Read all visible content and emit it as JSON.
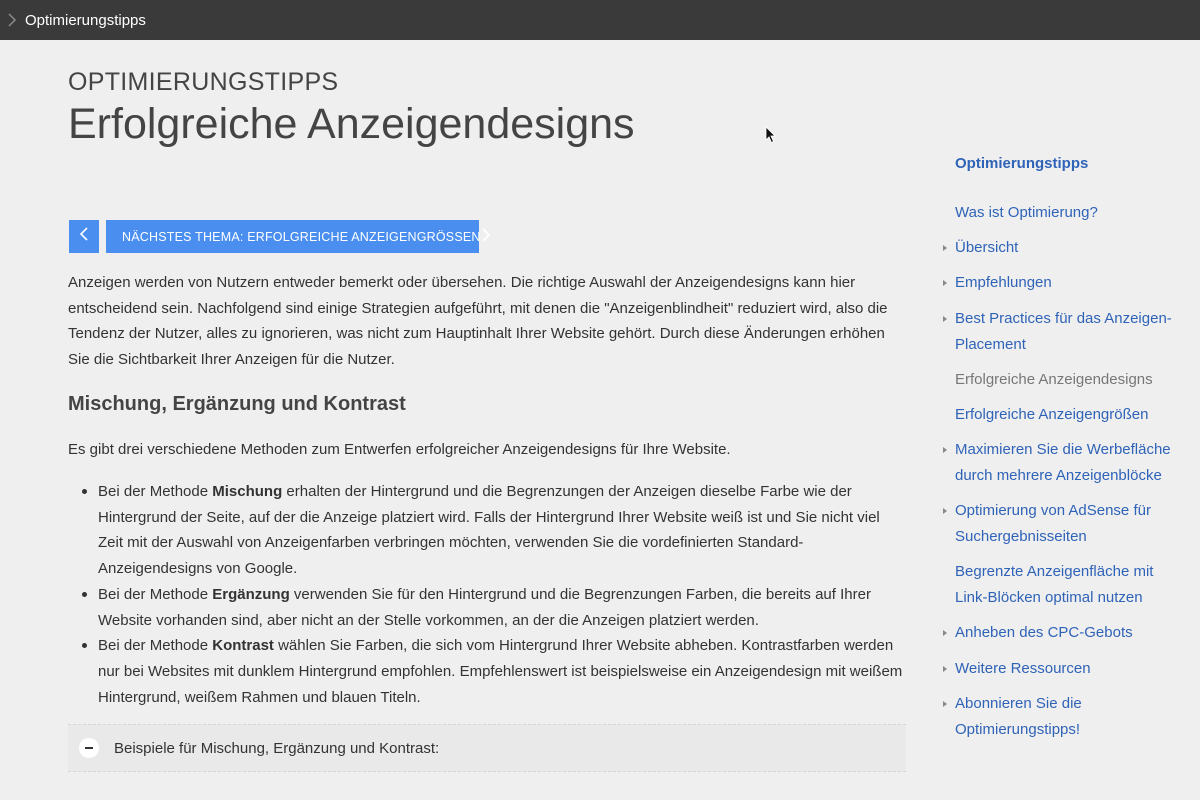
{
  "topbar": {
    "title": "Optimierungstipps"
  },
  "header": {
    "eyebrow": "OPTIMIERUNGSTIPPS",
    "title": "Erfolgreiche Anzeigendesigns"
  },
  "nav": {
    "next_label": "NÄCHSTES THEMA: ERFOLGREICHE ANZEIGENGRÖSSEN"
  },
  "intro": "Anzeigen werden von Nutzern entweder bemerkt oder übersehen. Die richtige Auswahl der Anzeigendesigns kann hier entscheidend sein. Nachfolgend sind einige Strategien aufgeführt, mit denen die \"Anzeigenblindheit\" reduziert wird, also die Tendenz der Nutzer, alles zu ignorieren, was nicht zum Hauptinhalt Ihrer Website gehört. Durch diese Änderungen erhöhen Sie die Sichtbarkeit Ihrer Anzeigen für die Nutzer.",
  "section": {
    "heading": "Mischung, Ergänzung und Kontrast",
    "lead": "Es gibt drei verschiedene Methoden zum Entwerfen erfolgreicher Anzeigendesigns für Ihre Website.",
    "bullets": [
      {
        "pre": "Bei der Methode ",
        "bold": "Mischung",
        "post": " erhalten der Hintergrund und die Begrenzungen der Anzeigen dieselbe Farbe wie der Hintergrund der Seite, auf der die Anzeige platziert wird. Falls der Hintergrund Ihrer Website weiß ist und Sie nicht viel Zeit mit der Auswahl von Anzeigenfarben verbringen möchten, verwenden Sie die vordefinierten Standard-Anzeigendesigns von Google."
      },
      {
        "pre": "Bei der Methode ",
        "bold": "Ergänzung",
        "post": " verwenden Sie für den Hintergrund und die Begrenzungen Farben, die bereits auf Ihrer Website vorhanden sind, aber nicht an der Stelle vorkommen, an der die Anzeigen platziert werden."
      },
      {
        "pre": "Bei der Methode ",
        "bold": "Kontrast",
        "post": " wählen Sie Farben, die sich vom Hintergrund Ihrer Website abheben. Kontrastfarben werden nur bei Websites mit dunklem Hintergrund empfohlen. Empfehlenswert ist beispielsweise ein Anzeigendesign mit weißem Hintergrund, weißem Rahmen und blauen Titeln."
      }
    ],
    "accordion_label": "Beispiele für Mischung, Ergänzung und Kontrast:"
  },
  "sidebar": {
    "heading": "Optimierungstipps",
    "items": [
      {
        "label": "Was ist Optimierung?",
        "caret": false,
        "current": false
      },
      {
        "label": "Übersicht",
        "caret": true,
        "current": false
      },
      {
        "label": "Empfehlungen",
        "caret": true,
        "current": false
      },
      {
        "label": "Best Practices für das Anzeigen-Placement",
        "caret": true,
        "current": false
      },
      {
        "label": "Erfolgreiche Anzeigendesigns",
        "caret": false,
        "current": true
      },
      {
        "label": "Erfolgreiche Anzeigengrößen",
        "caret": false,
        "current": false
      },
      {
        "label": "Maximieren Sie die Werbefläche durch mehrere Anzeigenblöcke",
        "caret": true,
        "current": false
      },
      {
        "label": "Optimierung von AdSense für Suchergebnisseiten",
        "caret": true,
        "current": false
      },
      {
        "label": "Begrenzte Anzeigenfläche mit Link-Blöcken optimal nutzen",
        "caret": false,
        "current": false
      },
      {
        "label": "Anheben des CPC-Gebots",
        "caret": true,
        "current": false
      },
      {
        "label": "Weitere Ressourcen",
        "caret": true,
        "current": false
      },
      {
        "label": "Abonnieren Sie die Optimierungstipps!",
        "caret": true,
        "current": false
      }
    ]
  },
  "icons": {
    "topbar": "chevron-right-icon",
    "prev": "chevron-left-icon",
    "next": "chevron-right-icon",
    "accordion": "minus-icon"
  },
  "colors": {
    "topbar_bg": "#3a3a3a",
    "accent_button": "#4a8ff0",
    "link": "#2f63b8",
    "current_link": "#777777"
  }
}
